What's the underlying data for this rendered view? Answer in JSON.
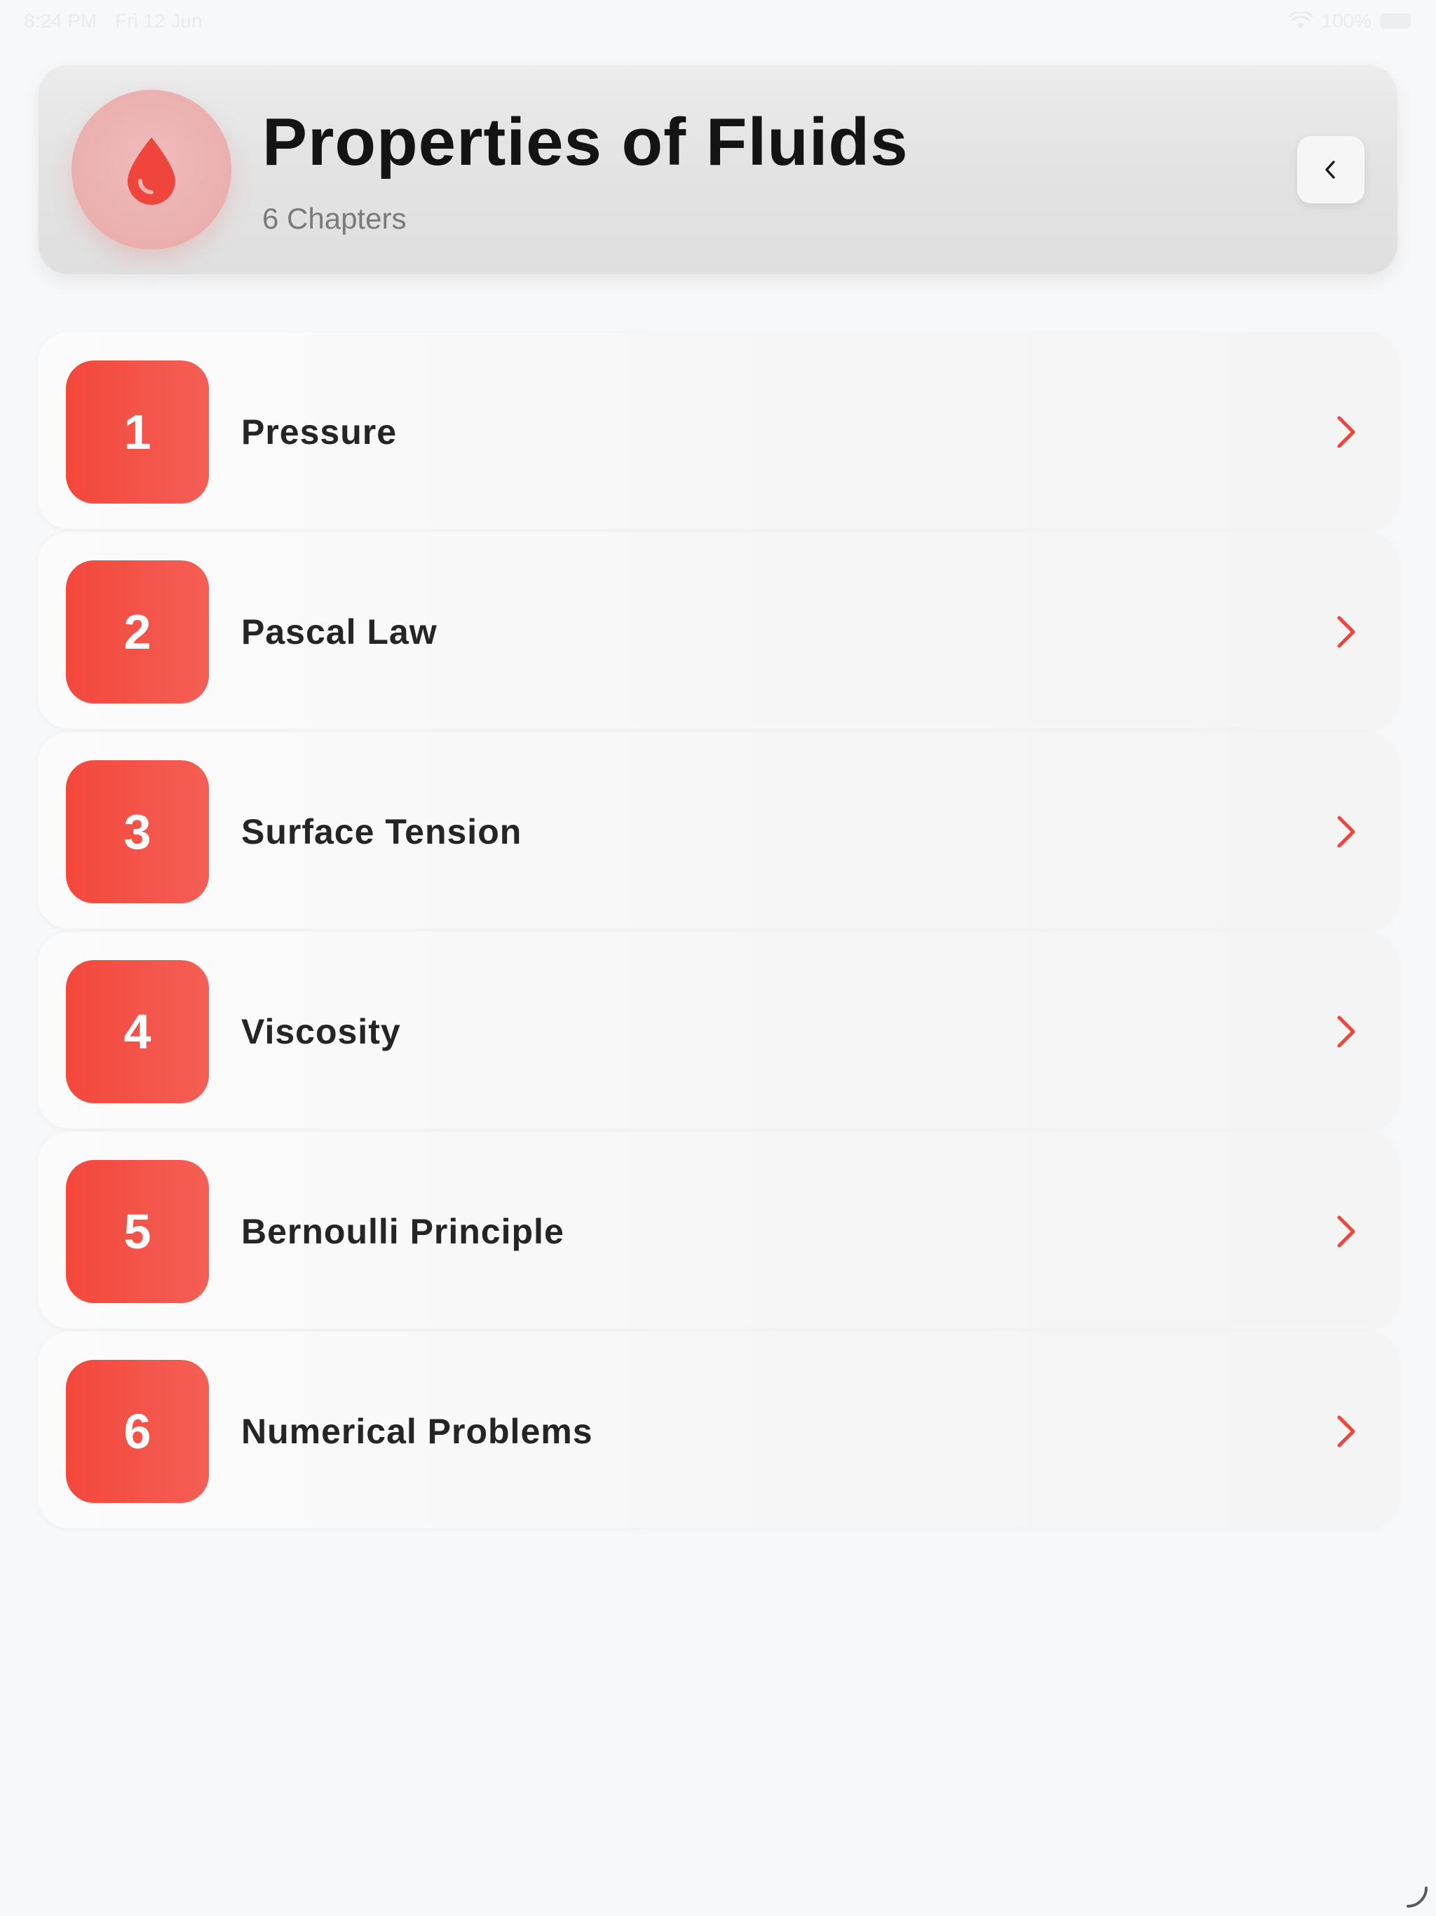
{
  "status_bar": {
    "time": "8:24 PM",
    "date": "Fri 12 Jun",
    "battery": "100%"
  },
  "header": {
    "title": "Properties of Fluids",
    "subtitle": "6 Chapters",
    "icon": "drop-icon",
    "back_icon": "chevron-left-icon"
  },
  "chapters": [
    {
      "number": "1",
      "title": "Pressure"
    },
    {
      "number": "2",
      "title": "Pascal Law"
    },
    {
      "number": "3",
      "title": "Surface Tension"
    },
    {
      "number": "4",
      "title": "Viscosity"
    },
    {
      "number": "5",
      "title": "Bernoulli Principle"
    },
    {
      "number": "6",
      "title": "Numerical Problems"
    }
  ],
  "colors": {
    "accent": "#f4473c",
    "accent_light": "#f45f55",
    "title_text": "#141414",
    "subtitle_text": "#7a7a7a",
    "background": "#f7f8fa"
  }
}
